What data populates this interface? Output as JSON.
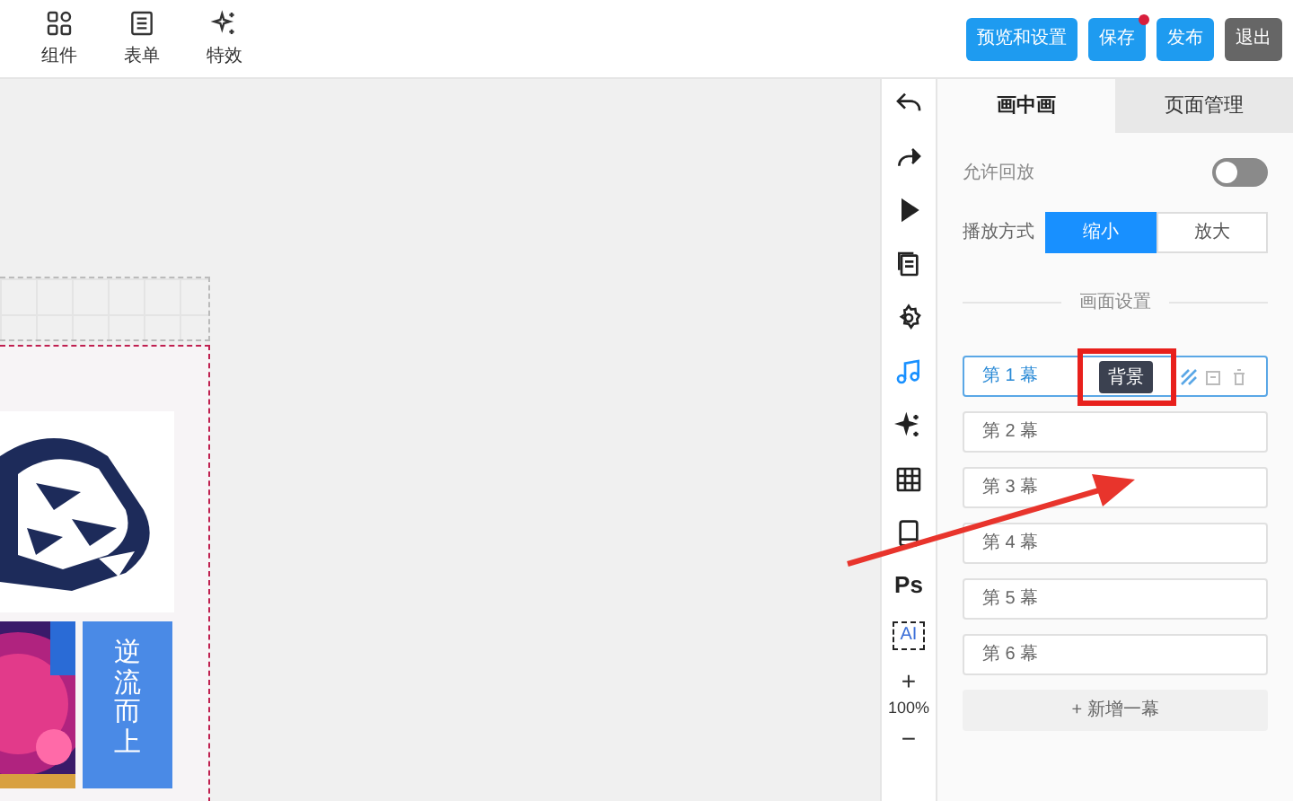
{
  "toolbar": {
    "tools": [
      {
        "kind": "components",
        "label": "组件"
      },
      {
        "kind": "form",
        "label": "表单"
      },
      {
        "kind": "effects",
        "label": "特效"
      }
    ],
    "actions": [
      {
        "label": "预览和设置",
        "kind": "primary",
        "dot": false
      },
      {
        "label": "保存",
        "kind": "primary",
        "dot": true
      },
      {
        "label": "发布",
        "kind": "primary",
        "dot": false
      },
      {
        "label": "退出",
        "kind": "dark",
        "dot": false
      }
    ]
  },
  "canvas": {
    "tile_text": "逆流而上"
  },
  "rail": {
    "items": [
      {
        "kind": "undo",
        "selected": false
      },
      {
        "kind": "redo",
        "selected": false
      },
      {
        "kind": "play",
        "selected": false
      },
      {
        "kind": "pages",
        "selected": false
      },
      {
        "kind": "settings",
        "selected": false
      },
      {
        "kind": "music",
        "selected": true
      },
      {
        "kind": "sparkle",
        "selected": false
      },
      {
        "kind": "grid",
        "selected": false
      },
      {
        "kind": "phone",
        "selected": false
      },
      {
        "kind": "ps",
        "selected": false,
        "label": "Ps"
      },
      {
        "kind": "ai",
        "selected": false,
        "label": "AI"
      }
    ],
    "zoom": {
      "plus": "+",
      "value": "100%",
      "minus": "−"
    }
  },
  "panel": {
    "tabs": [
      {
        "label": "画中画",
        "selected": true
      },
      {
        "label": "页面管理",
        "selected": false
      }
    ],
    "replay": {
      "label": "允许回放",
      "on": false
    },
    "mode": {
      "label": "播放方式",
      "options": [
        {
          "label": "缩小",
          "selected": true
        },
        {
          "label": "放大",
          "selected": false
        }
      ]
    },
    "section_title": "画面设置",
    "scenes": [
      {
        "label": "第 1 幕",
        "selected": true
      },
      {
        "label": "第 2 幕",
        "selected": false
      },
      {
        "label": "第 3 幕",
        "selected": false
      },
      {
        "label": "第 4 幕",
        "selected": false
      },
      {
        "label": "第 5 幕",
        "selected": false
      },
      {
        "label": "第 6 幕",
        "selected": false
      }
    ],
    "tooltip": "背景",
    "add_button": "+ 新增一幕"
  }
}
